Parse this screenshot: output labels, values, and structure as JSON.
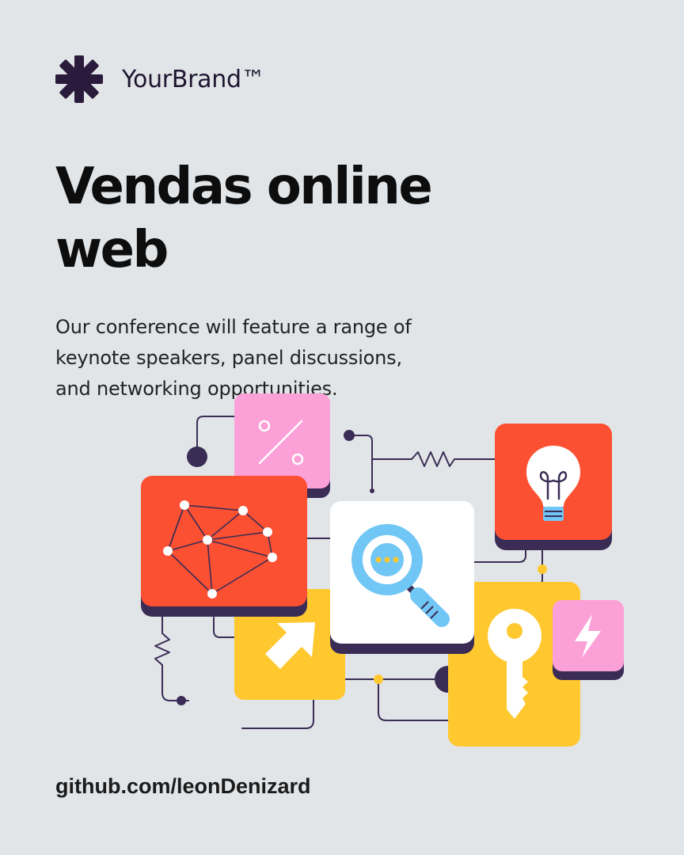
{
  "brand": {
    "name": "YourBrand™",
    "logo_icon": "asterisk-icon",
    "color": "#2a1a3c"
  },
  "headline": {
    "line1": "Vendas online",
    "line2": "web"
  },
  "description": {
    "line1": "Our conference will feature a range of",
    "line2": "keynote speakers, panel discussions,",
    "line3": "and networking opportunities."
  },
  "footer": {
    "link": "github.com/leonDenizard"
  },
  "illustration": {
    "tiles": [
      "percent-icon",
      "network-graph-icon",
      "magnifier-icon",
      "lightbulb-icon",
      "arrow-icon",
      "key-icon",
      "lightning-icon"
    ],
    "colors": {
      "background": "#e2e5e8",
      "orange": "#fc5033",
      "yellow": "#fec82e",
      "pink": "#fca0d8",
      "white": "#ffffff",
      "dark": "#3a2c55",
      "blue": "#70c6f4"
    }
  }
}
